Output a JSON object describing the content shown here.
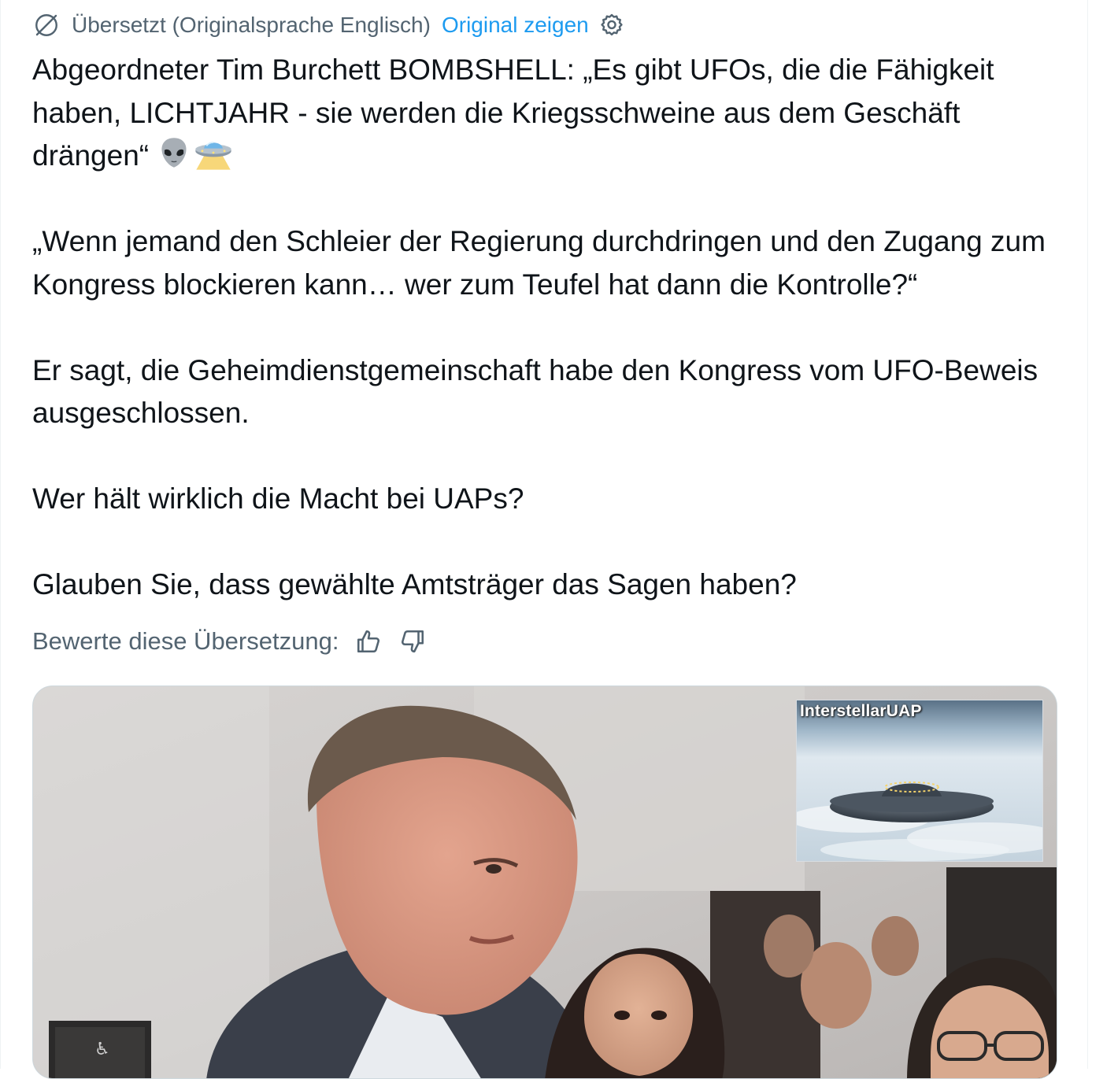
{
  "translation_bar": {
    "icon": "translate-icon",
    "label": "Übersetzt (Originalsprache Englisch)",
    "show_original": "Original zeigen",
    "settings_icon": "gear-icon"
  },
  "tweet": {
    "paragraphs": [
      "Abgeordneter Tim Burchett BOMBSHELL: „Es gibt UFOs, die die Fähigkeit haben, LICHTJAHR - sie werden die Kriegsschweine aus dem Geschäft drängen“",
      "„Wenn jemand den Schleier der Regierung durchdringen und den Zugang zum Kongress blockieren kann… wer zum Teufel hat dann die Kontrolle?“",
      "Er sagt, die Geheimdienstgemeinschaft habe den Kongress vom UFO-Beweis ausgeschlossen.",
      "Wer hält wirklich die Macht bei UAPs?",
      "Glauben Sie, dass gewählte Amtsträger das Sagen haben?"
    ],
    "emojis": [
      "alien-emoji",
      "ufo-emoji"
    ]
  },
  "rating": {
    "label": "Bewerte diese Übersetzung:",
    "icons": [
      "thumbs-up-icon",
      "thumbs-down-icon"
    ]
  },
  "media": {
    "watermark": "InterstellarUAP"
  },
  "colors": {
    "text": "#0f1419",
    "secondary": "#536471",
    "link": "#1d9bf0",
    "border": "#cfd9de"
  }
}
